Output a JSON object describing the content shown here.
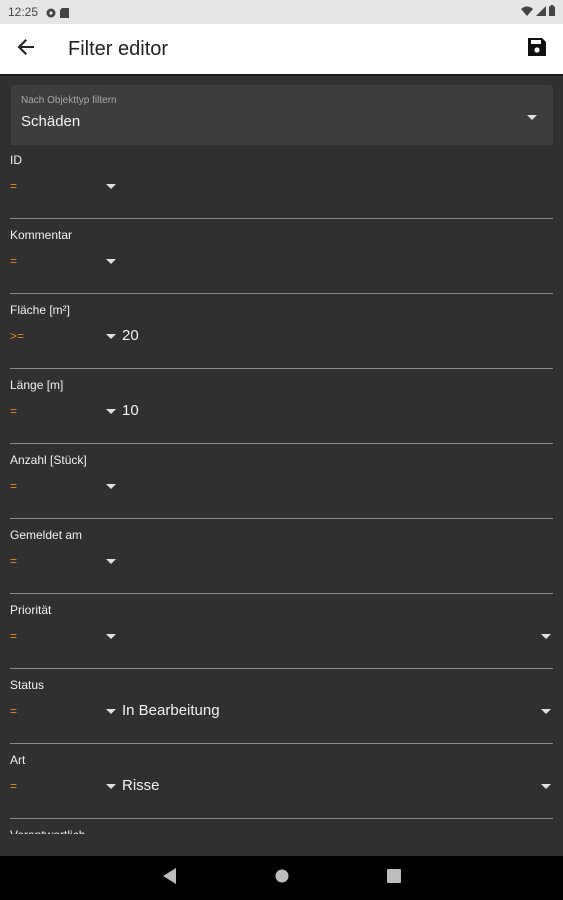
{
  "status_bar": {
    "time": "12:25",
    "left_icons": [
      "settings-notification-icon",
      "sim-icon"
    ],
    "right_icons": [
      "wifi-icon",
      "signal-icon",
      "battery-icon"
    ]
  },
  "app_bar": {
    "title": "Filter editor",
    "back_icon": "arrow-back-icon",
    "save_icon": "floppy-disk-save-icon"
  },
  "object_type": {
    "label": "Nach Objekttyp filtern",
    "value": "Schäden"
  },
  "fields": [
    {
      "label": "ID",
      "operator": "=",
      "value": "",
      "has_dropdown": false
    },
    {
      "label": "Kommentar",
      "operator": "=",
      "value": "",
      "has_dropdown": false
    },
    {
      "label": "Fläche [m²]",
      "operator": ">=",
      "value": "20",
      "has_dropdown": false
    },
    {
      "label": "Länge [m]",
      "operator": "=",
      "value": "10",
      "has_dropdown": false
    },
    {
      "label": "Anzahl [Stück]",
      "operator": "=",
      "value": "",
      "has_dropdown": false
    },
    {
      "label": "Gemeldet am",
      "operator": "=",
      "value": "",
      "has_dropdown": false
    },
    {
      "label": "Priorität",
      "operator": "=",
      "value": "",
      "has_dropdown": true
    },
    {
      "label": "Status",
      "operator": "=",
      "value": "In Bearbeitung",
      "has_dropdown": true
    },
    {
      "label": "Art",
      "operator": "=",
      "value": "Risse",
      "has_dropdown": true
    },
    {
      "label": "Verantwortlich",
      "operator": "",
      "value": "",
      "has_dropdown": false
    }
  ],
  "nav_bar": {
    "icons": [
      "back-triangle-icon",
      "home-circle-icon",
      "recents-square-icon"
    ]
  },
  "colors": {
    "operator": "#e48a1e",
    "background": "#303030",
    "app_bar": "#ffffff"
  }
}
